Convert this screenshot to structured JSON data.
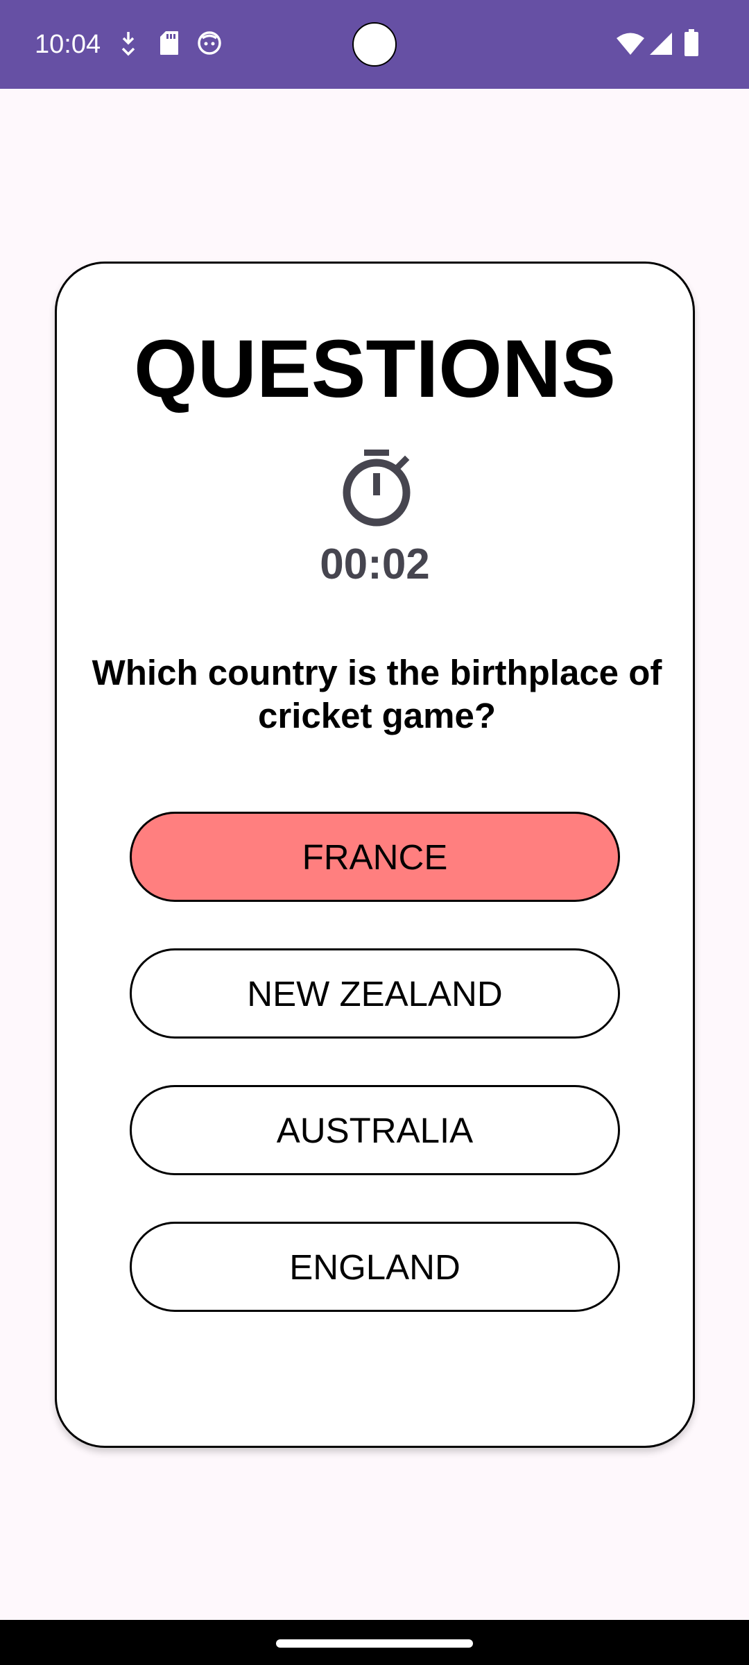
{
  "status_bar": {
    "time": "10:04",
    "background_color": "#6650a4",
    "left_icons": [
      "download-icon",
      "sd-card-icon",
      "face-icon"
    ],
    "right_icons": [
      "wifi-icon",
      "cellular-signal-icon",
      "battery-icon"
    ]
  },
  "card": {
    "title": "QUESTIONS",
    "timer_icon": "stopwatch-icon",
    "timer": "00:02",
    "question": "Which country is the birthplace of cricket game?",
    "answers": [
      {
        "label": "FRANCE",
        "selected": true,
        "color": "#ff7f7f"
      },
      {
        "label": "NEW ZEALAND",
        "selected": false
      },
      {
        "label": "AUSTRALIA",
        "selected": false
      },
      {
        "label": "ENGLAND",
        "selected": false
      }
    ]
  }
}
